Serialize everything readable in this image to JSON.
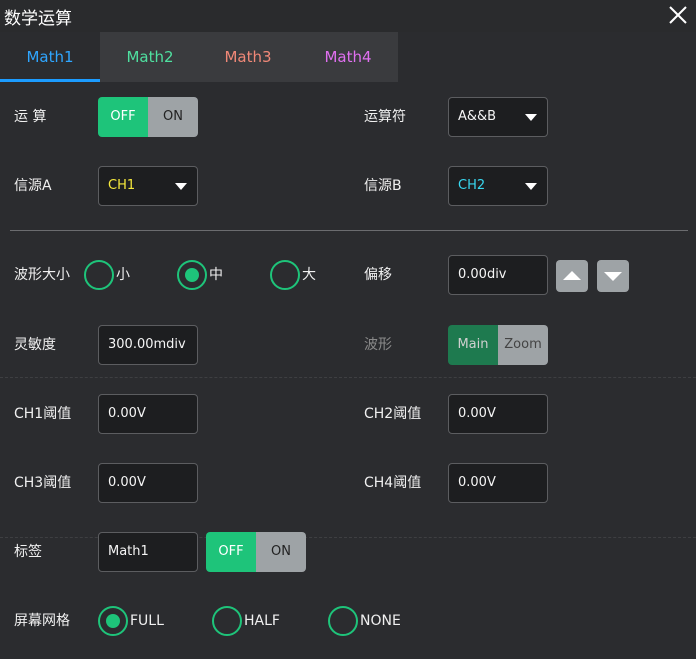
{
  "window": {
    "title": "数学运算"
  },
  "tabs": [
    {
      "label": "Math1",
      "color": "#2fa6ff"
    },
    {
      "label": "Math2",
      "color": "#4fe0a0"
    },
    {
      "label": "Math3",
      "color": "#f08878"
    },
    {
      "label": "Math4",
      "color": "#e070f0"
    }
  ],
  "operation": {
    "label": "运 算",
    "off": "OFF",
    "on": "ON",
    "state": "OFF"
  },
  "operator": {
    "label": "运算符",
    "value": "A&&B"
  },
  "sourceA": {
    "label": "信源A",
    "value": "CH1",
    "color": "#f5e83c"
  },
  "sourceB": {
    "label": "信源B",
    "value": "CH2",
    "color": "#38d8f0"
  },
  "wave_size": {
    "label": "波形大小",
    "options": [
      "小",
      "中",
      "大"
    ],
    "selected": "中"
  },
  "offset": {
    "label": "偏移",
    "value": "0.00div"
  },
  "sensitivity": {
    "label": "灵敏度",
    "value": "300.00mdiv"
  },
  "waveform": {
    "label": "波形",
    "main": "Main",
    "zoom": "Zoom"
  },
  "thresholds": {
    "ch1": {
      "label": "CH1阈值",
      "value": "0.00V"
    },
    "ch2": {
      "label": "CH2阈值",
      "value": "0.00V"
    },
    "ch3": {
      "label": "CH3阈值",
      "value": "0.00V"
    },
    "ch4": {
      "label": "CH4阈值",
      "value": "0.00V"
    }
  },
  "tag": {
    "label": "标签",
    "value": "Math1",
    "off": "OFF",
    "on": "ON",
    "state": "OFF"
  },
  "grid": {
    "label": "屏幕网格",
    "options": [
      "FULL",
      "HALF",
      "NONE"
    ],
    "selected": "FULL"
  },
  "colors": {
    "accent_green": "#1ec47a",
    "active_tab_line": "#1c9cff"
  }
}
